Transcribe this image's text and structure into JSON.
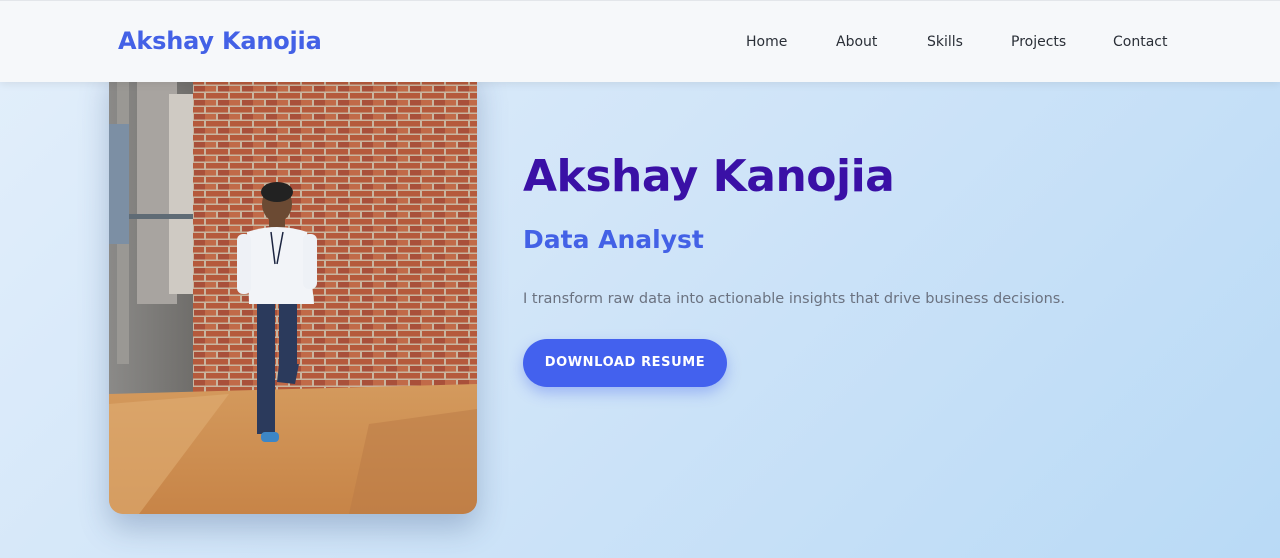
{
  "header": {
    "brand": "Akshay Kanojia",
    "nav": [
      {
        "label": "Home"
      },
      {
        "label": "About"
      },
      {
        "label": "Skills"
      },
      {
        "label": "Projects"
      },
      {
        "label": "Contact"
      }
    ]
  },
  "hero": {
    "name": "Akshay Kanojia",
    "role": "Data Analyst",
    "tagline": "I transform raw data into actionable insights that drive business decisions.",
    "resume_button": "DOWNLOAD RESUME"
  },
  "colors": {
    "brand": "#4361e6",
    "name": "#3a10a6",
    "button": "#4361ee",
    "tagline": "#6b7280"
  },
  "icons": {
    "photo": "profile-photo"
  }
}
